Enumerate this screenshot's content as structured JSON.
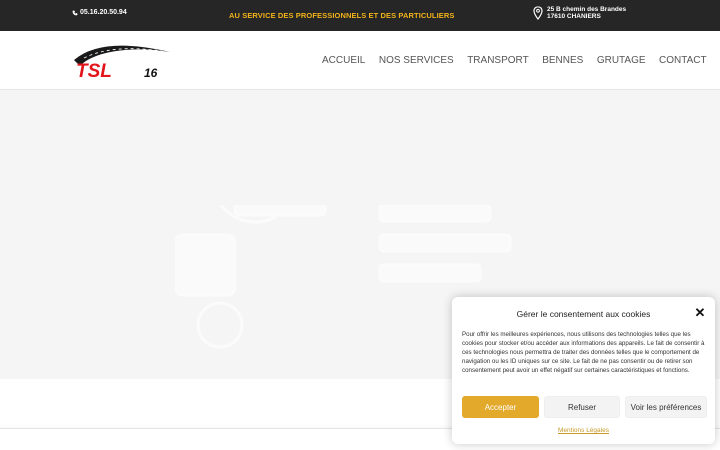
{
  "topbar": {
    "phone": "05.16.20.50.94",
    "tagline": "AU SERVICE DES PROFESSIONNELS ET DES PARTICULIERS",
    "address_line1": "25 B chemin des Brandes",
    "address_line2": "17610 CHANIERS"
  },
  "logo": {
    "text": "TSL16"
  },
  "nav": {
    "items": [
      {
        "label": "ACCUEIL"
      },
      {
        "label": "NOS SERVICES"
      },
      {
        "label": "TRANSPORT"
      },
      {
        "label": "BENNES"
      },
      {
        "label": "GRUTAGE"
      },
      {
        "label": "CONTACT"
      }
    ]
  },
  "cookie": {
    "title": "Gérer le consentement aux cookies",
    "body": "Pour offrir les meilleures expériences, nous utilisons des technologies telles que les cookies pour stocker et/ou accéder aux informations des appareils. Le fait de consentir à ces technologies nous permettra de traiter des données telles que le comportement de navigation ou les ID uniques sur ce site. Le fait de ne pas consentir ou de retirer son consentement peut avoir un effet négatif sur certaines caractéristiques et fonctions.",
    "accept": "Accepter",
    "refuse": "Refuser",
    "prefs": "Voir les préférences",
    "legal": "Mentions Légales",
    "close_symbol": "✕"
  },
  "colors": {
    "topbar_bg": "#262626",
    "tagline": "#f2b31a",
    "accent": "#e3a92b",
    "logo_red": "#e3151b"
  }
}
